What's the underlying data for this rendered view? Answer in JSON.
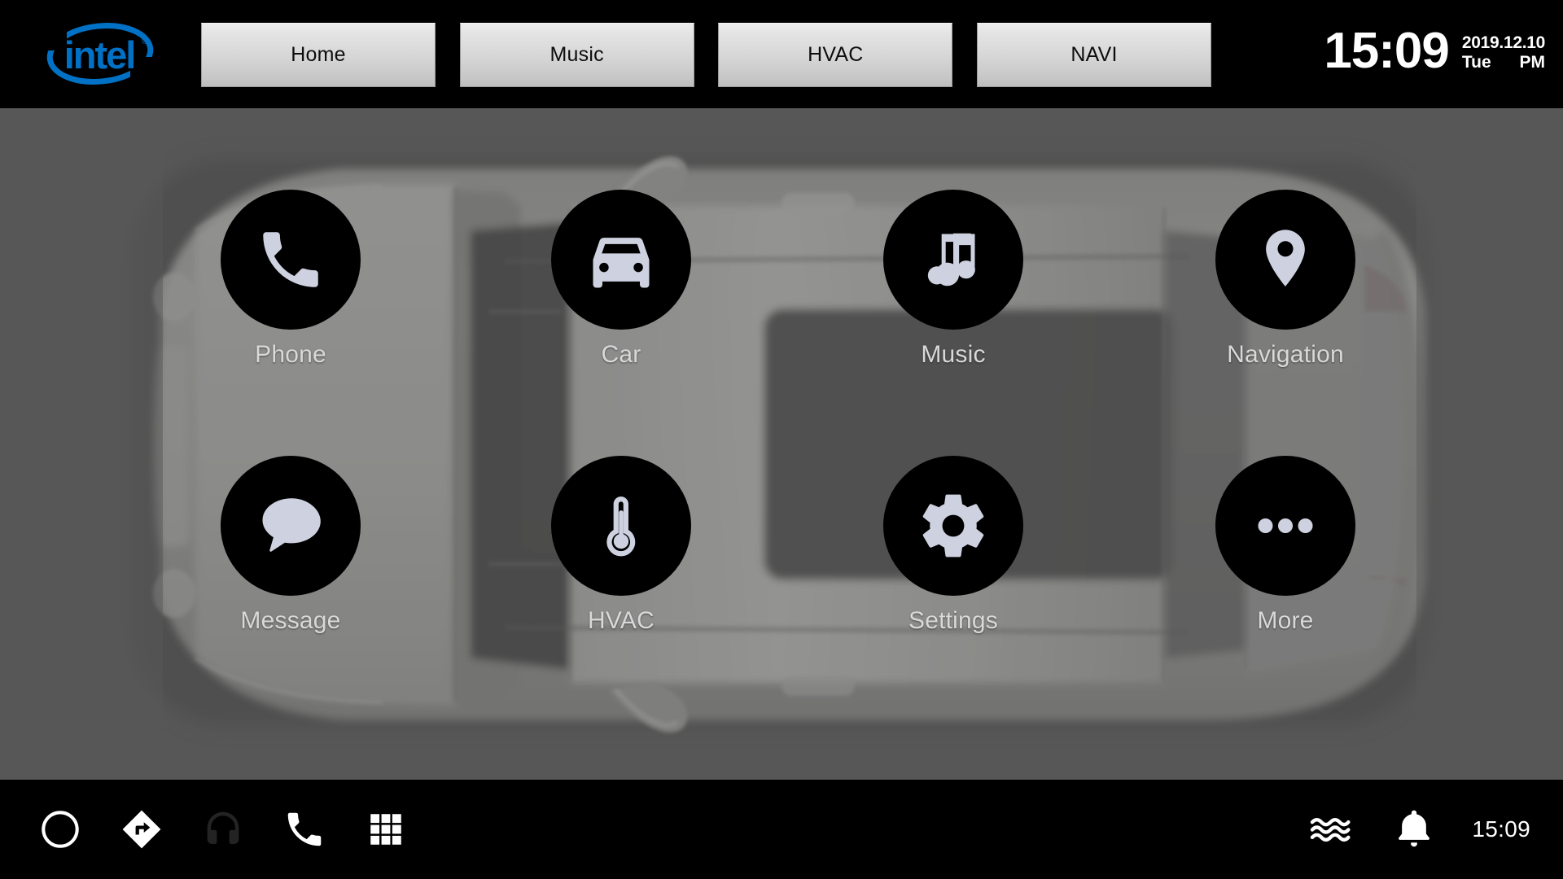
{
  "topbar": {
    "brand": {
      "name": "intel-logo",
      "wordmark": "intel",
      "registered": "®",
      "color": "#0071c5"
    },
    "tabs": [
      {
        "label": "Home",
        "name": "tab-home"
      },
      {
        "label": "Music",
        "name": "tab-music"
      },
      {
        "label": "HVAC",
        "name": "tab-hvac"
      },
      {
        "label": "NAVI",
        "name": "tab-navi"
      }
    ],
    "clock": {
      "time": "15:09",
      "date": "2019.12.10",
      "weekday": "Tue",
      "meridiem": "PM"
    }
  },
  "main": {
    "background_color": "#585858",
    "wallpaper": "top-down-car-photo",
    "apps": [
      {
        "label": "Phone",
        "icon": "phone-icon"
      },
      {
        "label": "Car",
        "icon": "car-icon"
      },
      {
        "label": "Music",
        "icon": "music-note-icon"
      },
      {
        "label": "Navigation",
        "icon": "map-pin-icon"
      },
      {
        "label": "Message",
        "icon": "speech-bubble-icon"
      },
      {
        "label": "HVAC",
        "icon": "thermometer-icon"
      },
      {
        "label": "Settings",
        "icon": "gear-icon"
      },
      {
        "label": "More",
        "icon": "ellipsis-icon"
      }
    ],
    "icon_circle_color": "#000000",
    "icon_glyph_color": "#ced2e0",
    "label_color": "#d9d9d9"
  },
  "bottombar": {
    "background_color": "#000000",
    "left_icons": [
      {
        "name": "home-circle-icon",
        "label": "Home"
      },
      {
        "name": "navigation-diamond-icon",
        "label": "Navigation"
      },
      {
        "name": "headphones-icon",
        "label": "Media",
        "state": "dimmed"
      },
      {
        "name": "phone-handset-icon",
        "label": "Phone"
      },
      {
        "name": "app-grid-icon",
        "label": "All apps"
      }
    ],
    "right_icons": [
      {
        "name": "airflow-waves-icon",
        "label": "Climate airflow"
      },
      {
        "name": "bell-icon",
        "label": "Notifications"
      }
    ],
    "time": "15:09"
  }
}
